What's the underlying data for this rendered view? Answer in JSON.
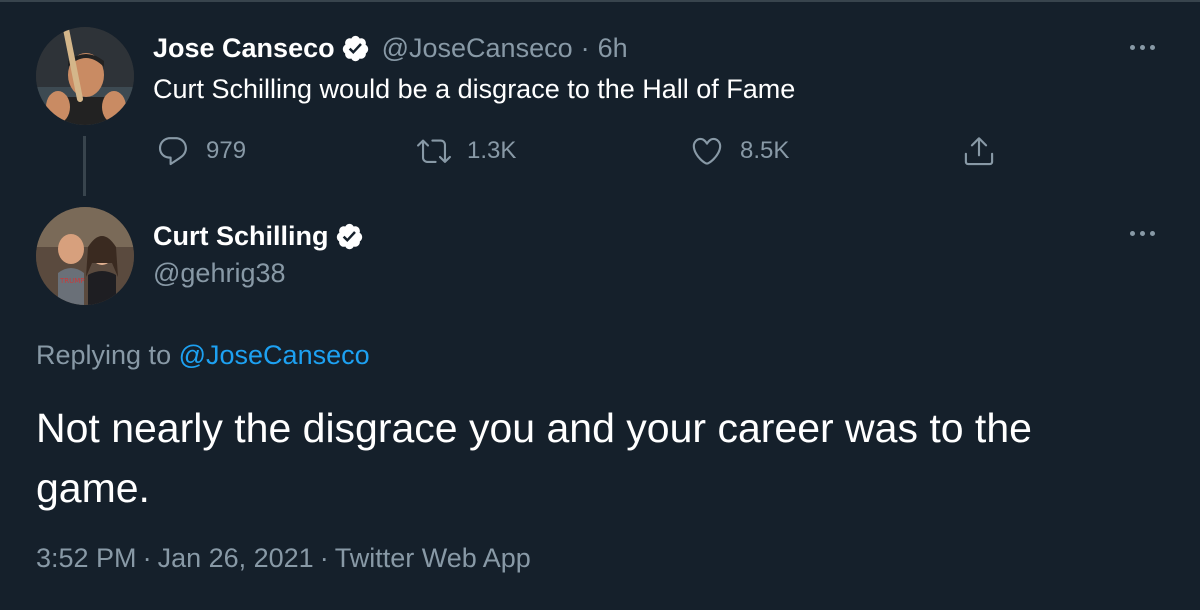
{
  "parent_tweet": {
    "display_name": "Jose Canseco",
    "handle": "@JoseCanseco",
    "separator": "·",
    "time": "6h",
    "text": "Curt Schilling would be a disgrace to the Hall of Fame",
    "actions": {
      "reply_count": "979",
      "retweet_count": "1.3K",
      "like_count": "8.5K"
    },
    "avatar_icon": "baseball-player-avatar"
  },
  "reply_tweet": {
    "display_name": "Curt Schilling",
    "handle": "@gehrig38",
    "replying_prefix": "Replying to",
    "replying_to": "@JoseCanseco",
    "text": "Not nearly the disgrace you and your career was to the game.",
    "timestamp": "3:52 PM",
    "date": "Jan 26, 2021",
    "source": "Twitter Web App",
    "separator": "·",
    "avatar_icon": "couple-photo-avatar"
  },
  "colors": {
    "background": "#15202b",
    "primary_text": "#ffffff",
    "secondary_text": "#8899a6",
    "link": "#1da1f2",
    "divider": "#38444d"
  }
}
